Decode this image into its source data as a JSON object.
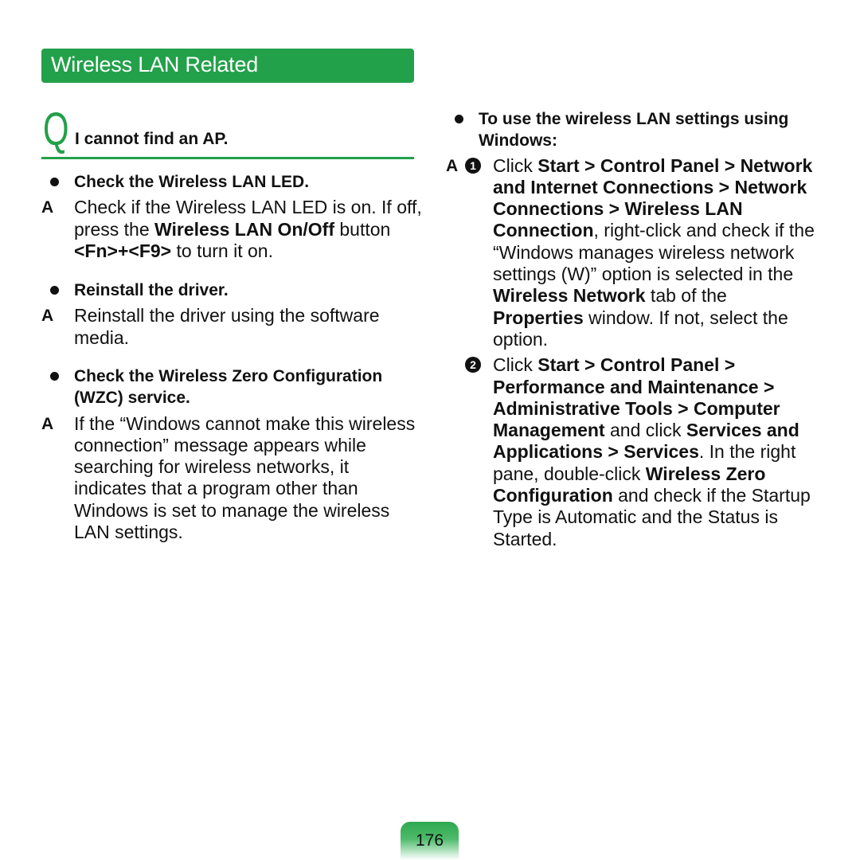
{
  "header": {
    "title": "Wireless LAN Related"
  },
  "question": {
    "marker": "Q",
    "text": "I cannot find an AP."
  },
  "answer_marker": "A",
  "left": {
    "items": [
      {
        "title": "Check the Wireless LAN LED.",
        "answer": {
          "t1": "Check if the Wireless LAN LED is on. If off, press the ",
          "b1": "Wireless LAN On/Off",
          "t2": " button ",
          "b2": "<Fn>+<F9>",
          "t3": " to turn it on."
        }
      },
      {
        "title": "Reinstall the driver.",
        "answer": {
          "t1": "Reinstall the driver using the software media."
        }
      },
      {
        "title": "Check the Wireless Zero Configuration (WZC) service.",
        "answer": {
          "t1": "If the “Windows cannot make this wireless connection” message appears while searching for wireless networks, it indicates that a program other than Windows is set to manage the wireless LAN settings."
        }
      }
    ]
  },
  "right": {
    "title": "To use the wireless LAN settings using Windows:",
    "steps": [
      {
        "number": "1",
        "t1": "Click ",
        "b1": "Start > Control Panel > Network and Internet Connections > Network Connections > Wireless LAN Connection",
        "t2": ", right-click and check if the “Windows manages wireless network settings (W)” option is selected in the ",
        "b2": "Wireless Network",
        "t3": " tab of the ",
        "b3": "Properties",
        "t4": " window. If not, select the option."
      },
      {
        "number": "2",
        "t1": "Click ",
        "b1": "Start > Control Panel > Performance and Maintenance > Administrative Tools > Computer Management",
        "t2": " and click ",
        "b2": "Services and Applications > Services",
        "t3": ". In the right pane, double-click ",
        "b3": "Wireless Zero Configuration",
        "t4": " and check if the Startup Type is Automatic and the Status is Started."
      }
    ]
  },
  "footer": {
    "page_number": "176"
  },
  "colors": {
    "accent": "#23a04a",
    "text": "#111111"
  }
}
